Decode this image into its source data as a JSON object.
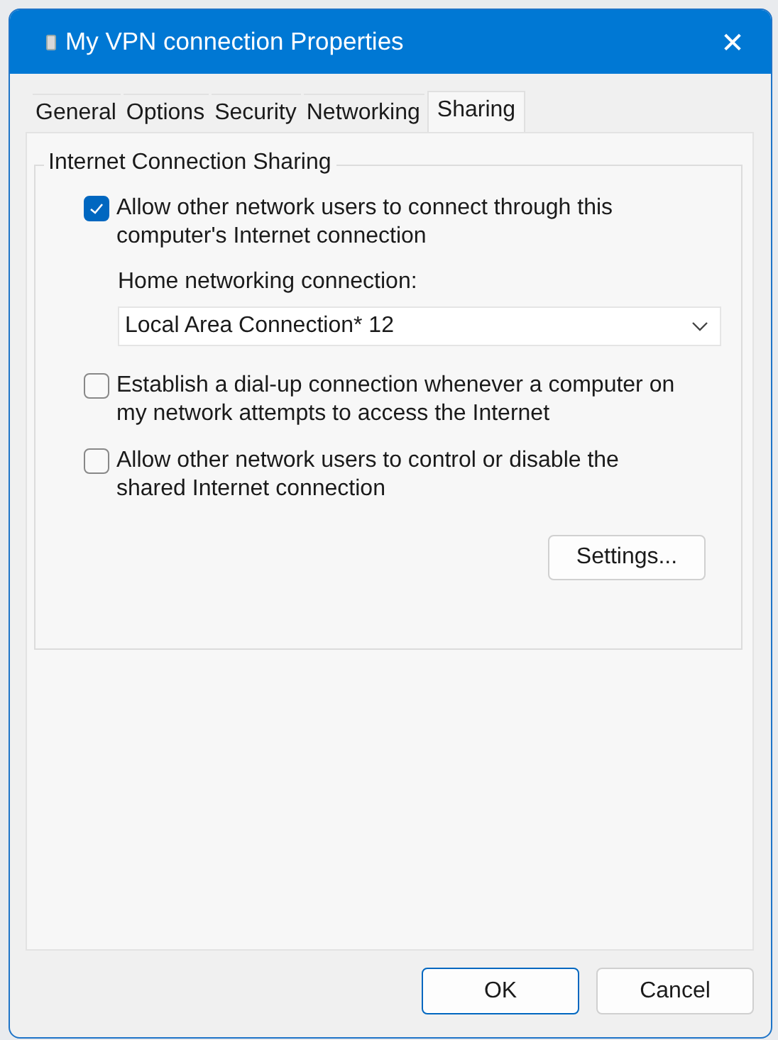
{
  "window": {
    "title": "My VPN connection Properties",
    "close": "✕"
  },
  "tabs": [
    {
      "label": "General",
      "selected": false
    },
    {
      "label": "Options",
      "selected": false
    },
    {
      "label": "Security",
      "selected": false
    },
    {
      "label": "Networking",
      "selected": false
    },
    {
      "label": "Sharing",
      "selected": true
    }
  ],
  "group": {
    "title": "Internet Connection Sharing",
    "options": [
      {
        "kind": "checkbox",
        "label": "Allow other network users to connect through this computer's Internet connection",
        "checked": true
      },
      {
        "kind": "dropdown",
        "label": "Home networking connection:",
        "value": "Local Area Connection* 12"
      },
      {
        "kind": "checkbox",
        "label": "Establish a dial-up connection whenever a computer on my network attempts to access the Internet",
        "checked": false
      },
      {
        "kind": "checkbox",
        "label": "Allow other network users to control or disable the shared Internet connection",
        "checked": false
      }
    ],
    "button": "Settings..."
  },
  "buttons": [
    {
      "label": "OK",
      "default": true
    },
    {
      "label": "Cancel",
      "default": false
    }
  ]
}
